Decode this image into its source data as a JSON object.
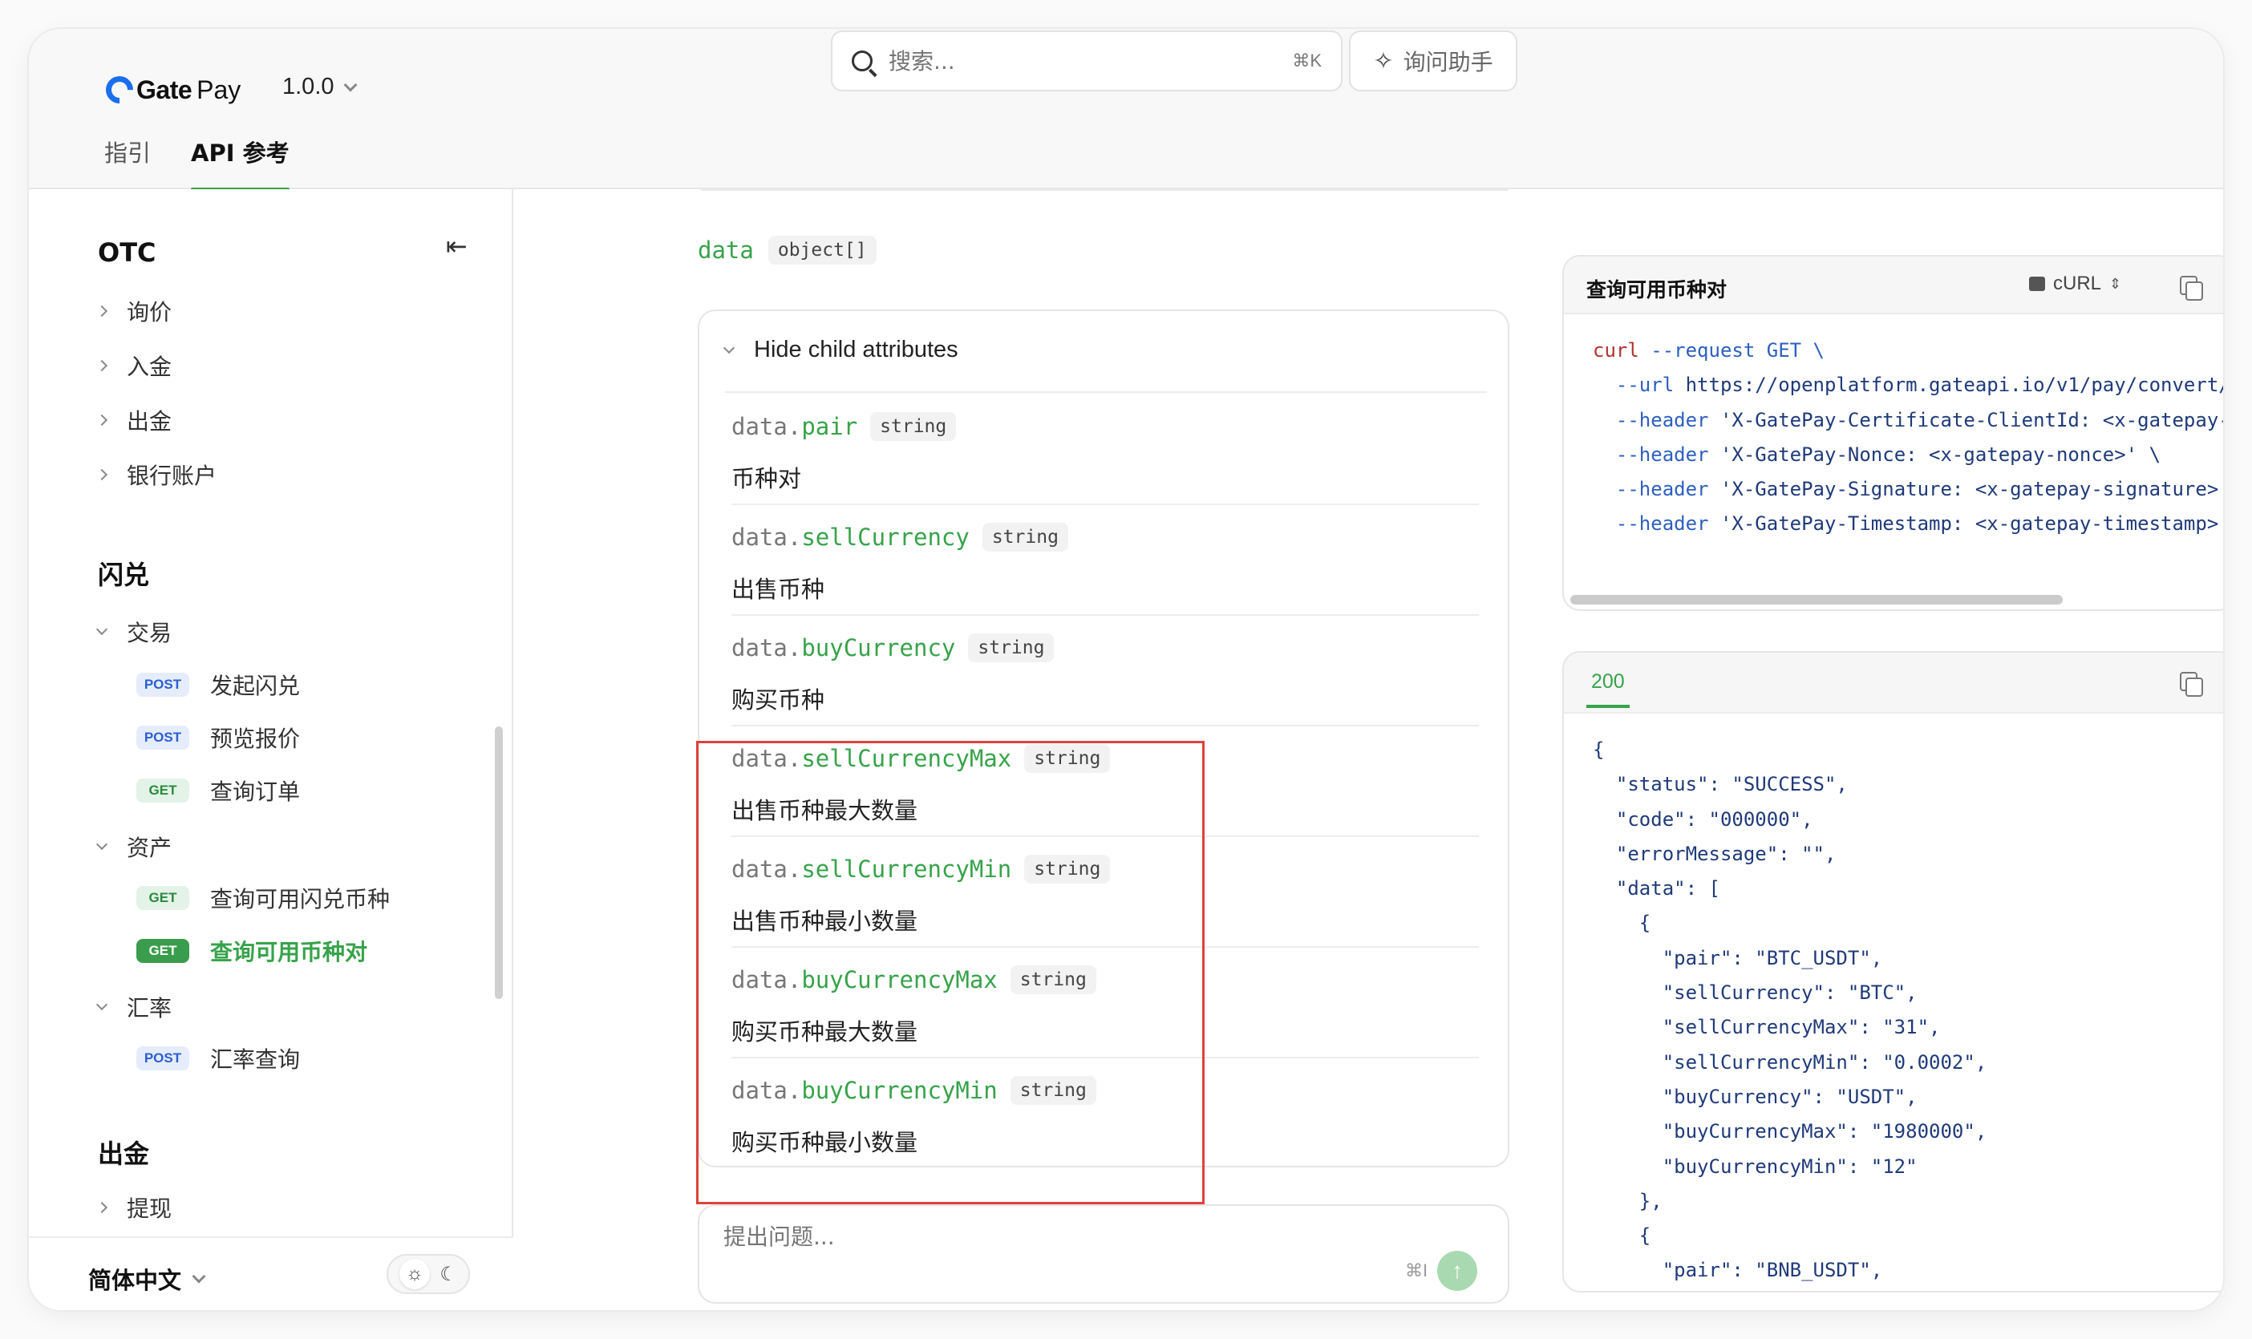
{
  "header": {
    "brand": {
      "gate": "Gate",
      "pay": "Pay"
    },
    "version": "1.0.0",
    "search": {
      "placeholder": "搜索...",
      "shortcut": "⌘K"
    },
    "assistant_label": "询问助手",
    "tabs": [
      {
        "label": "指引",
        "active": false
      },
      {
        "label": "API 参考",
        "active": true
      }
    ]
  },
  "sidebar": {
    "sections": [
      {
        "title": "OTC",
        "groups": [
          {
            "label": "询价",
            "expanded": false
          },
          {
            "label": "入金",
            "expanded": false
          },
          {
            "label": "出金",
            "expanded": false
          },
          {
            "label": "银行账户",
            "expanded": false
          }
        ]
      },
      {
        "title": "闪兑",
        "groups": [
          {
            "label": "交易",
            "expanded": true,
            "endpoints": [
              {
                "method": "POST",
                "label": "发起闪兑"
              },
              {
                "method": "POST",
                "label": "预览报价"
              },
              {
                "method": "GET",
                "label": "查询订单"
              }
            ]
          },
          {
            "label": "资产",
            "expanded": true,
            "endpoints": [
              {
                "method": "GET",
                "label": "查询可用闪兑币种"
              },
              {
                "method": "GET",
                "label": "查询可用币种对",
                "active": true
              }
            ]
          },
          {
            "label": "汇率",
            "expanded": true,
            "endpoints": [
              {
                "method": "POST",
                "label": "汇率查询"
              }
            ]
          }
        ]
      },
      {
        "title": "出金",
        "partial_item": "提现"
      }
    ],
    "footer": {
      "language": "简体中文"
    }
  },
  "main": {
    "field": {
      "name": "data",
      "type": "object[]"
    },
    "child_toggle_label": "Hide child attributes",
    "attributes": [
      {
        "prefix": "data.",
        "key": "pair",
        "type": "string",
        "desc": "币种对"
      },
      {
        "prefix": "data.",
        "key": "sellCurrency",
        "type": "string",
        "desc": "出售币种"
      },
      {
        "prefix": "data.",
        "key": "buyCurrency",
        "type": "string",
        "desc": "购买币种"
      },
      {
        "prefix": "data.",
        "key": "sellCurrencyMax",
        "type": "string",
        "desc": "出售币种最大数量"
      },
      {
        "prefix": "data.",
        "key": "sellCurrencyMin",
        "type": "string",
        "desc": "出售币种最小数量"
      },
      {
        "prefix": "data.",
        "key": "buyCurrencyMax",
        "type": "string",
        "desc": "购买币种最大数量"
      },
      {
        "prefix": "data.",
        "key": "buyCurrencyMin",
        "type": "string",
        "desc": "购买币种最小数量"
      }
    ],
    "ask": {
      "placeholder": "提出问题...",
      "shortcut": "⌘I"
    }
  },
  "request_panel": {
    "title": "查询可用币种对",
    "language": "cURL",
    "lines": [
      [
        "curl",
        " --request GET \\"
      ],
      [
        "  --url",
        " https://openplatform.gateapi.io/v1/pay/convert/"
      ],
      [
        "  --header",
        " 'X-GatePay-Certificate-ClientId: <x-gatepay-"
      ],
      [
        "  --header",
        " 'X-GatePay-Nonce: <x-gatepay-nonce>' \\"
      ],
      [
        "  --header",
        " 'X-GatePay-Signature: <x-gatepay-signature>'"
      ],
      [
        "  --header",
        " 'X-GatePay-Timestamp: <x-gatepay-timestamp>'"
      ]
    ]
  },
  "response_panel": {
    "status": "200",
    "lines": [
      "{",
      "  \"status\": \"SUCCESS\",",
      "  \"code\": \"000000\",",
      "  \"errorMessage\": \"\",",
      "  \"data\": [",
      "    {",
      "      \"pair\": \"BTC_USDT\",",
      "      \"sellCurrency\": \"BTC\",",
      "      \"sellCurrencyMax\": \"31\",",
      "      \"sellCurrencyMin\": \"0.0002\",",
      "      \"buyCurrency\": \"USDT\",",
      "      \"buyCurrencyMax\": \"1980000\",",
      "      \"buyCurrencyMin\": \"12\"",
      "    },",
      "    {",
      "      \"pair\": \"BNB_USDT\","
    ]
  },
  "colors": {
    "accent": "#37a34a",
    "highlight": "#e0413b",
    "post_badge": "#2c5fd1",
    "get_badge": "#2a8a3e"
  }
}
